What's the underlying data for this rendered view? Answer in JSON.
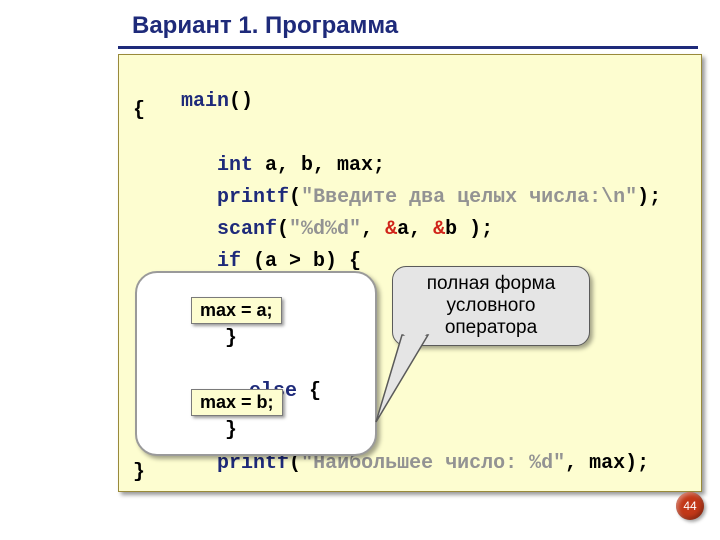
{
  "title": "Вариант 1. Программа",
  "code": {
    "l1_main": "main",
    "l1_rest": "()",
    "l2": "{",
    "l3_kw": "   int",
    "l3_rest": " a, b, max;",
    "l4_fn": "   printf",
    "l4_p1": "(",
    "l4_str": "\"Введите два целых числа:\\n\"",
    "l4_p2": ");",
    "l5_fn": "   scanf",
    "l5_p1": "(",
    "l5_str": "\"%d%d\"",
    "l5_mid1": ", ",
    "l5_amp1": "&",
    "l5_a": "a, ",
    "l5_amp2": "&",
    "l5_b": "b );",
    "l6_if": "   if",
    "l6_rest": " (a > b) {",
    "l7_close": "     }",
    "l8_else": "   else",
    "l8_rest": " {",
    "l9_close": "     }",
    "l10_fn": "   printf",
    "l10_p1": "(",
    "l10_str": "\"Наибольшее число: %d\"",
    "l10_rest": ", max);",
    "l11": "}"
  },
  "box_a": "max = a;",
  "box_b": "max = b;",
  "callout_l1": "полная форма",
  "callout_l2": "условного",
  "callout_l3": "оператора",
  "page_num": "44"
}
